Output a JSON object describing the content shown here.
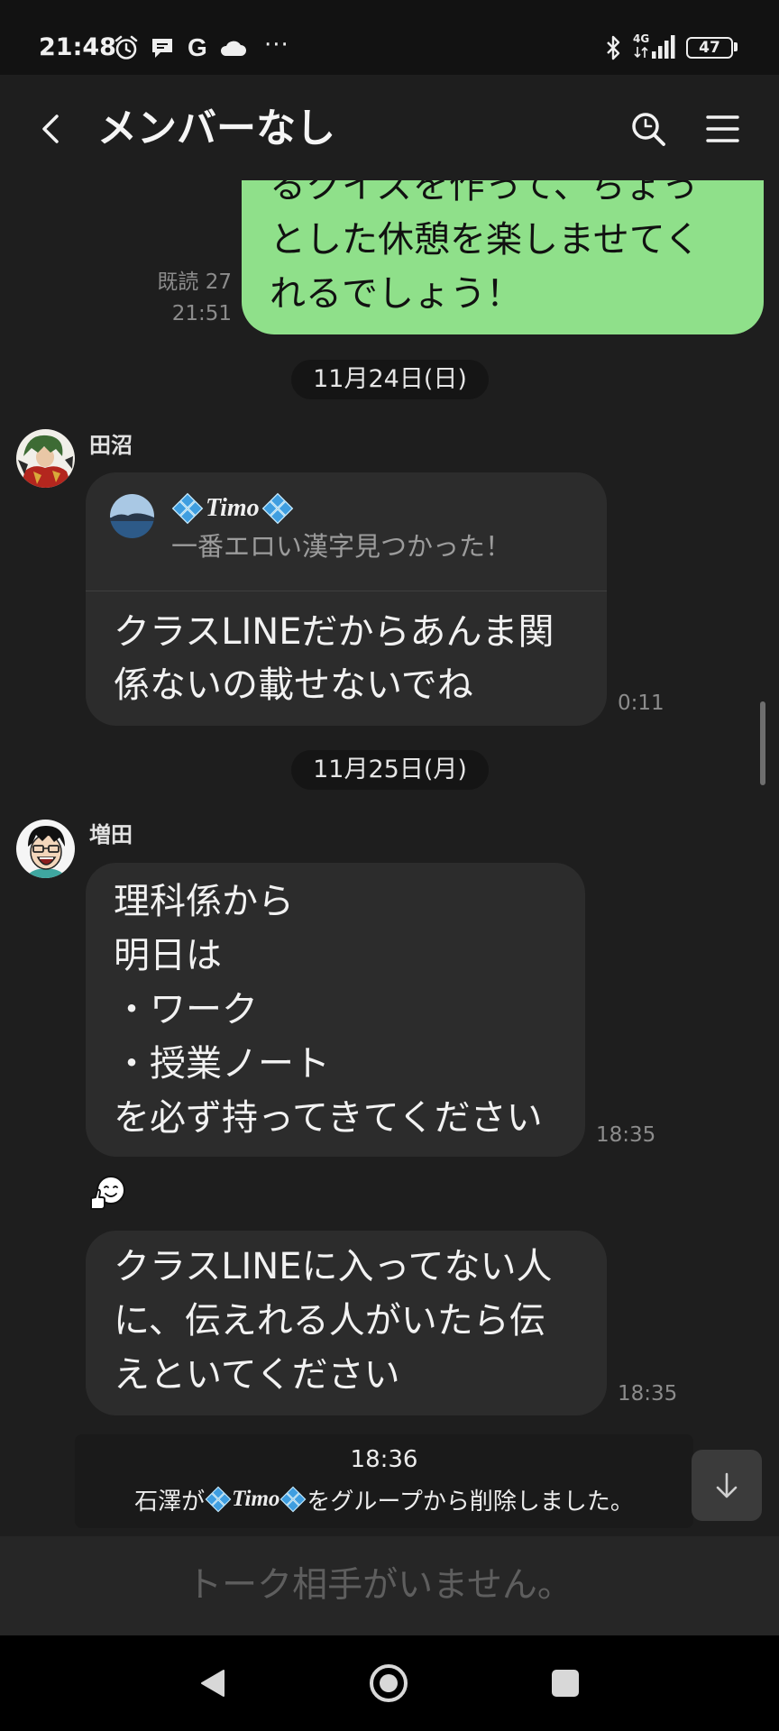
{
  "status_bar": {
    "time": "21:48",
    "notification_icons": [
      "alarm-icon",
      "message-bubble-icon",
      "google-icon",
      "cloud-icon"
    ],
    "google_label": "G",
    "more": "···",
    "network": "4G",
    "battery": "47",
    "system_icons": [
      "bluetooth-icon",
      "signal-icon",
      "battery-icon"
    ]
  },
  "header": {
    "title": "メンバーなし",
    "icons": {
      "back": "back-chevron-icon",
      "search": "search-icon",
      "menu": "menu-icon"
    }
  },
  "chat": {
    "outgoing": {
      "lines": [
        "るクイズを作って、ちょっ",
        "とした休憩を楽しませてく",
        "れるでしょう！"
      ],
      "read_label": "既読 27",
      "time": "21:51"
    },
    "date_1": "11月24日(日)",
    "message_1": {
      "sender": "田沼",
      "reply": {
        "sender": "Timo",
        "text": "一番エロい漢字見つかった！"
      },
      "lines": [
        "クラスLINEだからあんま関",
        "係ないの載せないでね"
      ],
      "time": "0:11"
    },
    "date_2": "11月25日(月)",
    "message_2": {
      "sender": "増田",
      "lines": [
        "理科係から",
        "明日は",
        "・ワーク",
        "・授業ノート",
        "を必ず持ってきてください"
      ],
      "time": "18:35"
    },
    "reaction_icon": "thumbs-up-face-icon",
    "message_3": {
      "lines": [
        "クラスLINEに入ってない人",
        "に、伝えれる人がいたら伝",
        "えといてください"
      ],
      "time": "18:35"
    },
    "system_message": {
      "time": "18:36",
      "prefix": "石澤が",
      "name": "Timo",
      "suffix": "をグループから削除しました。"
    }
  },
  "scroll_button_icon": "arrow-down-icon",
  "input_bar": {
    "placeholder": "トーク相手がいません。"
  },
  "nav_bar": {
    "icons": [
      "back-triangle-icon",
      "home-circle-icon",
      "recents-square-icon"
    ]
  },
  "colors": {
    "background": "#1e1e1e",
    "outgoing_bubble": "#8fe08a",
    "incoming_bubble": "#2c2c2c"
  }
}
